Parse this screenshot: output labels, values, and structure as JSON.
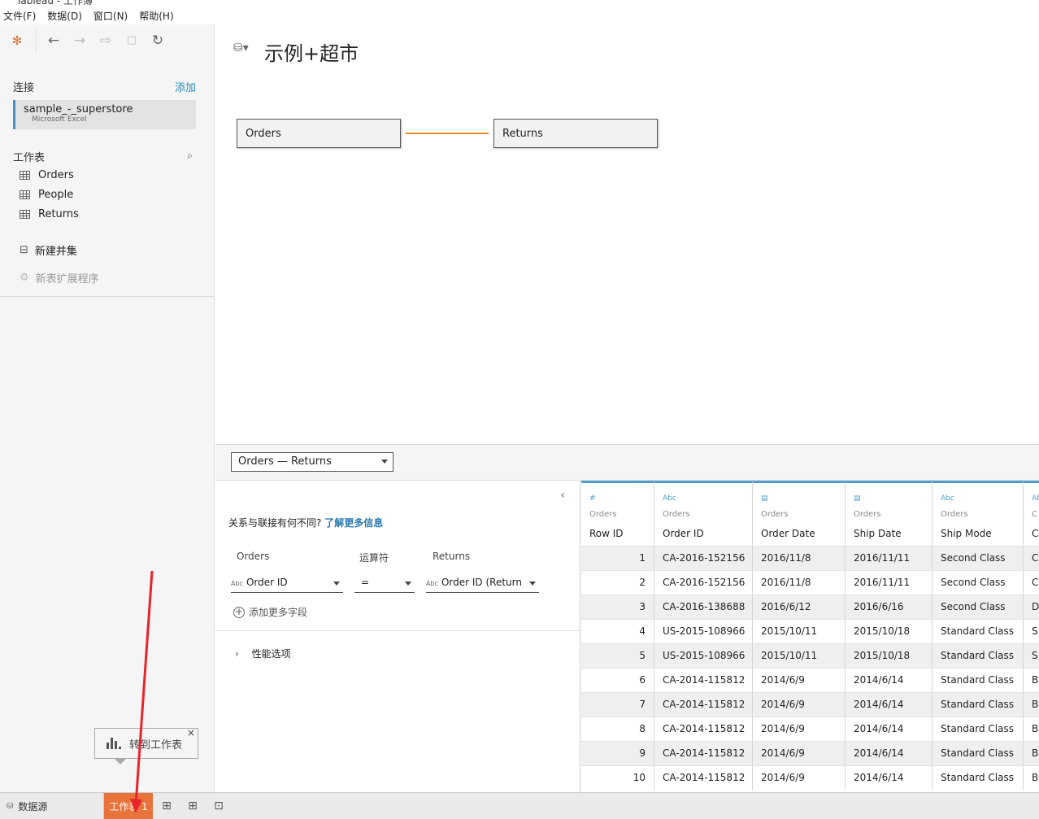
{
  "window": {
    "title": "Tableau - 工作簿"
  },
  "menu": [
    "文件(F)",
    "数据(D)",
    "窗口(N)",
    "帮助(H)"
  ],
  "toolbar": {
    "logo_icon": "tableau-logo-icon",
    "back_icon": "arrow-left-icon",
    "forward_icon": "arrow-right-icon",
    "redo_icon": "redo-icon",
    "save_icon": "save-icon",
    "refresh_icon": "refresh-icon"
  },
  "sidebar": {
    "connections_label": "连接",
    "add_label": "添加",
    "connection": {
      "name": "sample_-_superstore",
      "type": "Microsoft Excel"
    },
    "sheets_label": "工作表",
    "tables": [
      "Orders",
      "People",
      "Returns"
    ],
    "new_union": "新建并集",
    "new_extension": "新表扩展程序"
  },
  "canvas": {
    "datasource_title": "示例+超市",
    "left_table": "Orders",
    "right_table": "Returns",
    "link_color": "#e08a2e"
  },
  "relationship": {
    "selected": "Orders — Returns",
    "question": "关系与联接有何不同?",
    "learn_more": "了解更多信息",
    "headers": {
      "left": "Orders",
      "operator": "运算符",
      "right": "Returns"
    },
    "left_field": "Order ID",
    "operator": "=",
    "right_field": "Order ID (Return",
    "add_more": "添加更多字段",
    "performance": "性能选项"
  },
  "grid": {
    "columns": [
      {
        "type": "#",
        "source": "Orders",
        "name": "Row ID"
      },
      {
        "type": "Abc",
        "source": "Orders",
        "name": "Order ID"
      },
      {
        "type": "date-icon",
        "source": "Orders",
        "name": "Order Date"
      },
      {
        "type": "date-icon",
        "source": "Orders",
        "name": "Ship Date"
      },
      {
        "type": "Abc",
        "source": "Orders",
        "name": "Ship Mode"
      },
      {
        "type": "Abc",
        "source": "C",
        "name": "C"
      }
    ],
    "rows": [
      [
        "1",
        "CA-2016-152156",
        "2016/11/8",
        "2016/11/11",
        "Second Class",
        "C"
      ],
      [
        "2",
        "CA-2016-152156",
        "2016/11/8",
        "2016/11/11",
        "Second Class",
        "C"
      ],
      [
        "3",
        "CA-2016-138688",
        "2016/6/12",
        "2016/6/16",
        "Second Class",
        "D"
      ],
      [
        "4",
        "US-2015-108966",
        "2015/10/11",
        "2015/10/18",
        "Standard Class",
        "S"
      ],
      [
        "5",
        "US-2015-108966",
        "2015/10/11",
        "2015/10/18",
        "Standard Class",
        "S"
      ],
      [
        "6",
        "CA-2014-115812",
        "2014/6/9",
        "2014/6/14",
        "Standard Class",
        "B"
      ],
      [
        "7",
        "CA-2014-115812",
        "2014/6/9",
        "2014/6/14",
        "Standard Class",
        "B"
      ],
      [
        "8",
        "CA-2014-115812",
        "2014/6/9",
        "2014/6/14",
        "Standard Class",
        "B"
      ],
      [
        "9",
        "CA-2014-115812",
        "2014/6/9",
        "2014/6/14",
        "Standard Class",
        "B"
      ],
      [
        "10",
        "CA-2014-115812",
        "2014/6/9",
        "2014/6/14",
        "Standard Class",
        "B"
      ]
    ]
  },
  "tooltip": {
    "text": "转到工作表",
    "close": "×"
  },
  "bottom": {
    "datasource_tab": "数据源",
    "sheet_tab": "工作表 1",
    "sheet_tab_color": "#e8743b",
    "new_sheet_icon": "new-worksheet-icon",
    "new_dashboard_icon": "new-dashboard-icon",
    "new_story_icon": "new-story-icon"
  }
}
